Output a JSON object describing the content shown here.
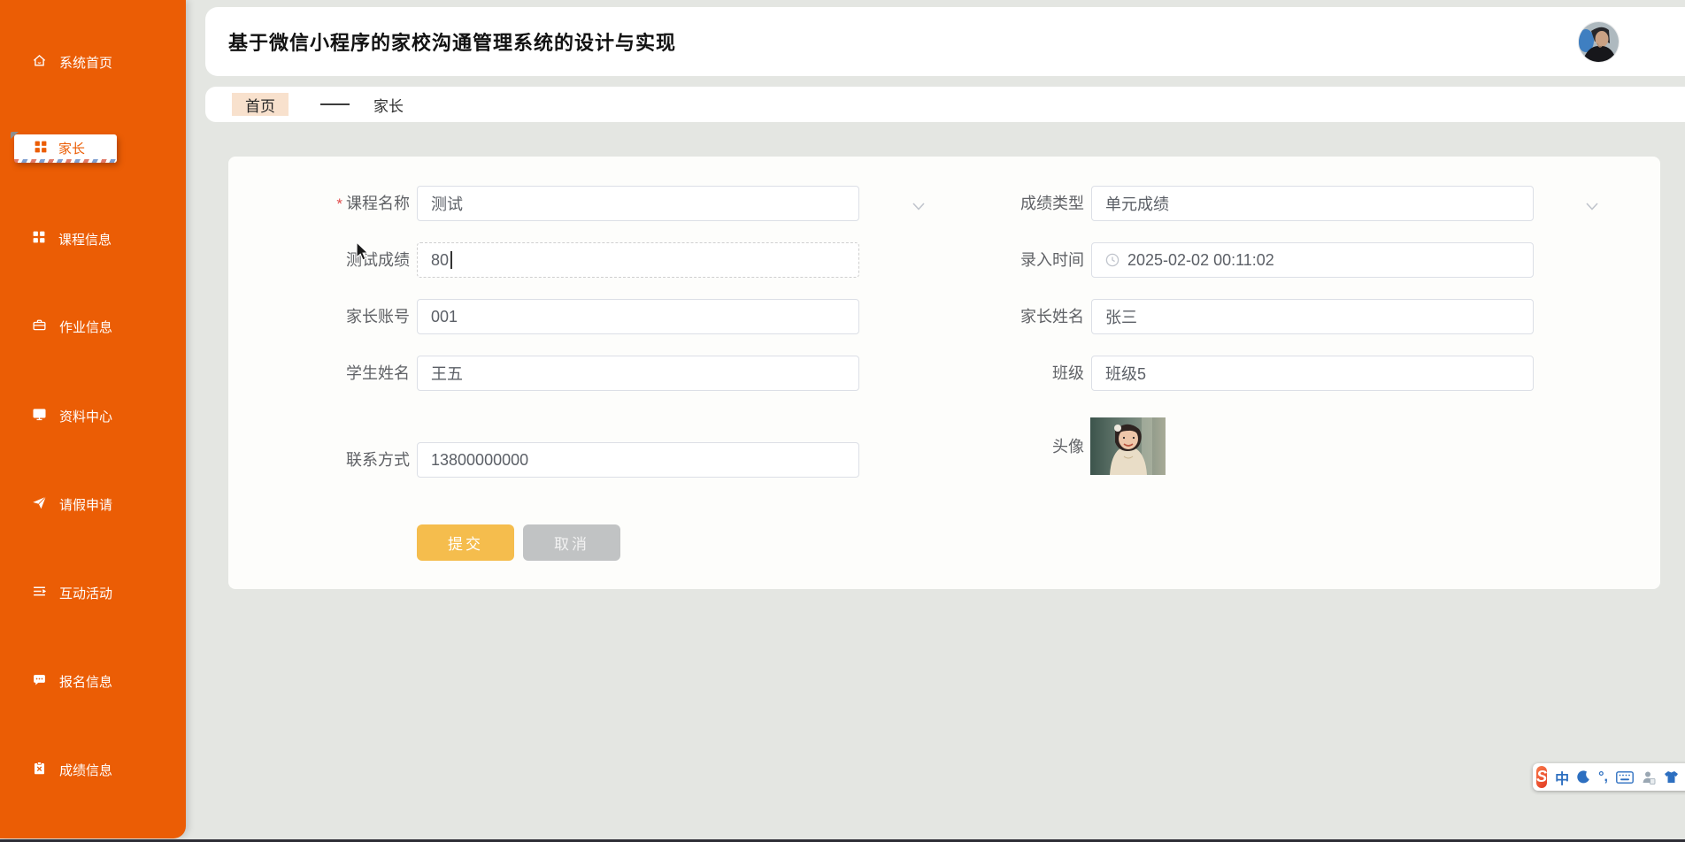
{
  "colors": {
    "sidebar_orange": "#EB5D05",
    "page_background": "#E4E6E2",
    "submit_button": "#F5BD4D",
    "cancel_button": "#C1C3C4",
    "breadcrumb_pill": "#F8E1CD",
    "input_border": "#DCDFE6",
    "ime_blue": "#2D6FC0"
  },
  "header": {
    "title": "基于微信小程序的家校沟通管理系统的设计与实现"
  },
  "breadcrumb": {
    "home": "首页",
    "separator": "——",
    "current": "家长"
  },
  "sidebar": {
    "items": [
      {
        "label": "系统首页",
        "icon": "home-icon",
        "active": false
      },
      {
        "label": "家长",
        "icon": "grid-icon",
        "active": true
      },
      {
        "label": "课程信息",
        "icon": "grid-icon",
        "active": false
      },
      {
        "label": "作业信息",
        "icon": "briefcase-icon",
        "active": false
      },
      {
        "label": "资料中心",
        "icon": "monitor-icon",
        "active": false
      },
      {
        "label": "请假申请",
        "icon": "paper-plane-icon",
        "active": false
      },
      {
        "label": "互动活动",
        "icon": "list-icon",
        "active": false
      },
      {
        "label": "报名信息",
        "icon": "chat-icon",
        "active": false
      },
      {
        "label": "成绩信息",
        "icon": "clipboard-x-icon",
        "active": false
      }
    ]
  },
  "form": {
    "fields": {
      "course_name": {
        "label": "课程名称",
        "required": "*",
        "value": "测试"
      },
      "test_score": {
        "label": "测试成绩",
        "value": "80"
      },
      "parent_account": {
        "label": "家长账号",
        "value": "001"
      },
      "student_name": {
        "label": "学生姓名",
        "value": "王五"
      },
      "contact": {
        "label": "联系方式",
        "value": "13800000000"
      },
      "score_type": {
        "label": "成绩类型",
        "value": "单元成绩"
      },
      "entry_time": {
        "label": "录入时间",
        "value": "2025-02-02 00:11:02"
      },
      "parent_name": {
        "label": "家长姓名",
        "value": "张三"
      },
      "class_name": {
        "label": "班级",
        "value": "班级5"
      },
      "avatar": {
        "label": "头像"
      }
    },
    "buttons": {
      "submit": "提交",
      "cancel": "取消"
    }
  },
  "ime": {
    "logo_letter": "S",
    "mode_label": "中",
    "punctuation_label": "°,"
  }
}
